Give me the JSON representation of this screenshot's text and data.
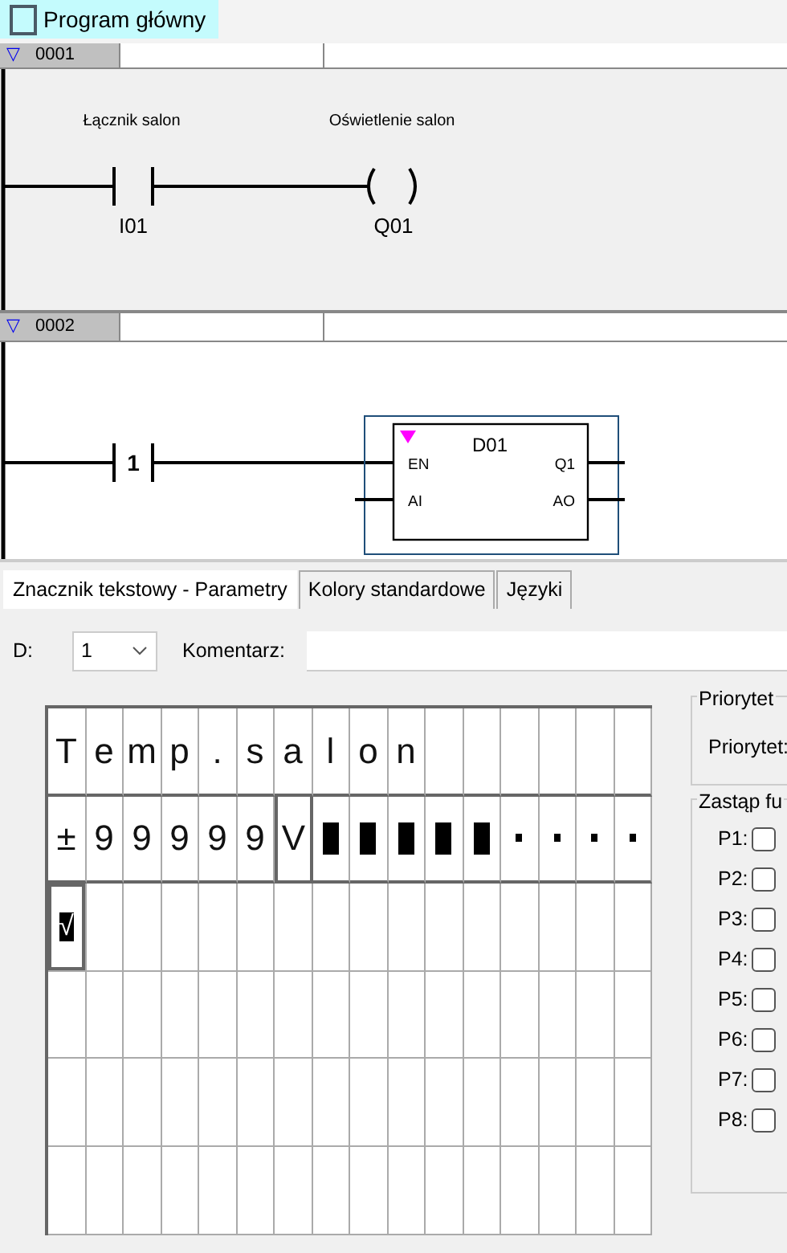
{
  "program_tab": {
    "title": "Program główny",
    "checked": false
  },
  "rungs": [
    {
      "number": "0001",
      "marker": "▽",
      "kind": "contact-coil",
      "contact": {
        "comment": "Łącznik salon",
        "address": "I01"
      },
      "coil": {
        "comment": "Oświetlenie salon",
        "address": "Q01"
      }
    },
    {
      "number": "0002",
      "marker": "▽",
      "kind": "contact-block",
      "contact": {
        "address": "1"
      },
      "block": {
        "name": "D01",
        "inputs": [
          "EN",
          "AI"
        ],
        "outputs": [
          "Q1",
          "AO"
        ]
      }
    }
  ],
  "tabs": [
    {
      "label": "Znacznik tekstowy - Parametry",
      "selected": true
    },
    {
      "label": "Kolory standardowe",
      "selected": false
    },
    {
      "label": "Języki",
      "selected": false
    }
  ],
  "d_select": {
    "label": "D:",
    "value": "1"
  },
  "comment_field": {
    "label": "Komentarz:"
  },
  "lcd_rows": [
    [
      {
        "kind": "char",
        "text": "T"
      },
      {
        "kind": "char",
        "text": "e"
      },
      {
        "kind": "char",
        "text": "m"
      },
      {
        "kind": "char",
        "text": "p"
      },
      {
        "kind": "char",
        "text": "."
      },
      {
        "kind": "char",
        "text": "s"
      },
      {
        "kind": "char",
        "text": "a"
      },
      {
        "kind": "char",
        "text": "l"
      },
      {
        "kind": "char",
        "text": "o"
      },
      {
        "kind": "char",
        "text": "n"
      }
    ],
    [
      {
        "kind": "char",
        "text": "±"
      },
      {
        "kind": "char",
        "text": "9"
      },
      {
        "kind": "char",
        "text": "9"
      },
      {
        "kind": "char",
        "text": "9"
      },
      {
        "kind": "char",
        "text": "9"
      },
      {
        "kind": "char",
        "text": "9"
      },
      {
        "kind": "field-char",
        "text": "V"
      },
      {
        "kind": "block"
      },
      {
        "kind": "block"
      },
      {
        "kind": "block"
      },
      {
        "kind": "block"
      },
      {
        "kind": "block"
      },
      {
        "kind": "dot"
      },
      {
        "kind": "dot"
      },
      {
        "kind": "dot"
      },
      {
        "kind": "dot"
      }
    ],
    [
      {
        "kind": "cursor",
        "text": "√"
      }
    ]
  ],
  "priority_group": {
    "title": "Priorytet",
    "label": "Priorytet:"
  },
  "replace_group": {
    "title": "Zastąp fu",
    "items": [
      {
        "label": "P1:",
        "checked": false
      },
      {
        "label": "P2:",
        "checked": false
      },
      {
        "label": "P3:",
        "checked": false
      },
      {
        "label": "P4:",
        "checked": false
      },
      {
        "label": "P5:",
        "checked": false
      },
      {
        "label": "P6:",
        "checked": false
      },
      {
        "label": "P7:",
        "checked": false
      },
      {
        "label": "P8:",
        "checked": false
      }
    ]
  }
}
